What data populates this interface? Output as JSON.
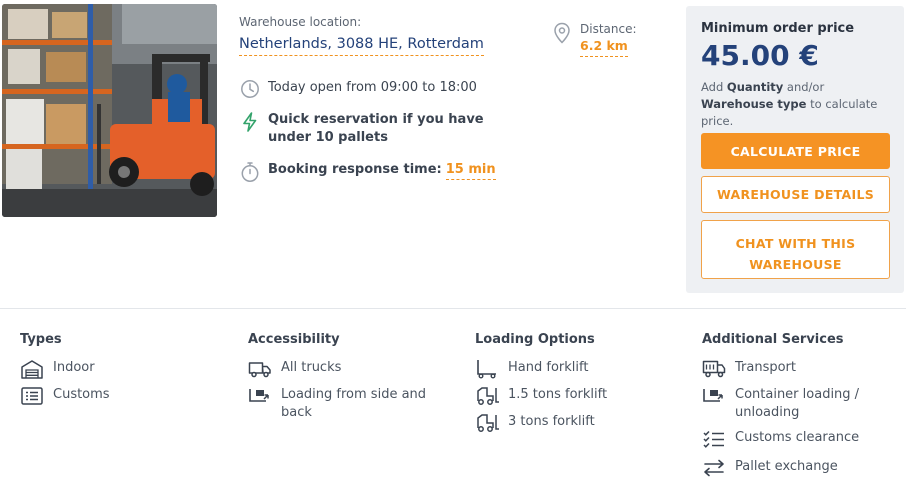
{
  "colors": {
    "accent": "#f59324",
    "brand": "#24427a",
    "panel": "#eef0f3",
    "quick_icon": "#33a36b"
  },
  "listing": {
    "photo_icon": "warehouse-forklift-photo",
    "location_label": "Warehouse location:",
    "location_value": "Netherlands, 3088 HE, Rotterdam",
    "distance_label": "Distance:",
    "distance_value": "6.2 km",
    "hours": "Today open from 09:00 to 18:00",
    "quick_reservation": "Quick reservation if you have under 10 pallets",
    "response_label": "Booking response time:",
    "response_value": "15 min"
  },
  "pricing": {
    "min_label": "Minimum order price",
    "price": "45.00 €",
    "note_pre": "Add ",
    "note_quantity": "Quantity",
    "note_mid": " and/or ",
    "note_type": "Warehouse type",
    "note_post": " to calculate price.",
    "calculate_label": "CALCULATE PRICE",
    "details_label": "WAREHOUSE DETAILS",
    "chat_label": "CHAT WITH THIS WAREHOUSE"
  },
  "sections": {
    "types": {
      "title": "Types",
      "items": [
        "Indoor",
        "Customs"
      ]
    },
    "accessibility": {
      "title": "Accessibility",
      "items": [
        "All trucks",
        "Loading from side and back"
      ]
    },
    "loading": {
      "title": "Loading Options",
      "items": [
        "Hand forklift",
        "1.5 tons forklift",
        "3 tons forklift"
      ]
    },
    "services": {
      "title": "Additional Services",
      "items": [
        "Transport",
        "Container loading / unloading",
        "Customs clearance",
        "Pallet exchange"
      ]
    }
  }
}
